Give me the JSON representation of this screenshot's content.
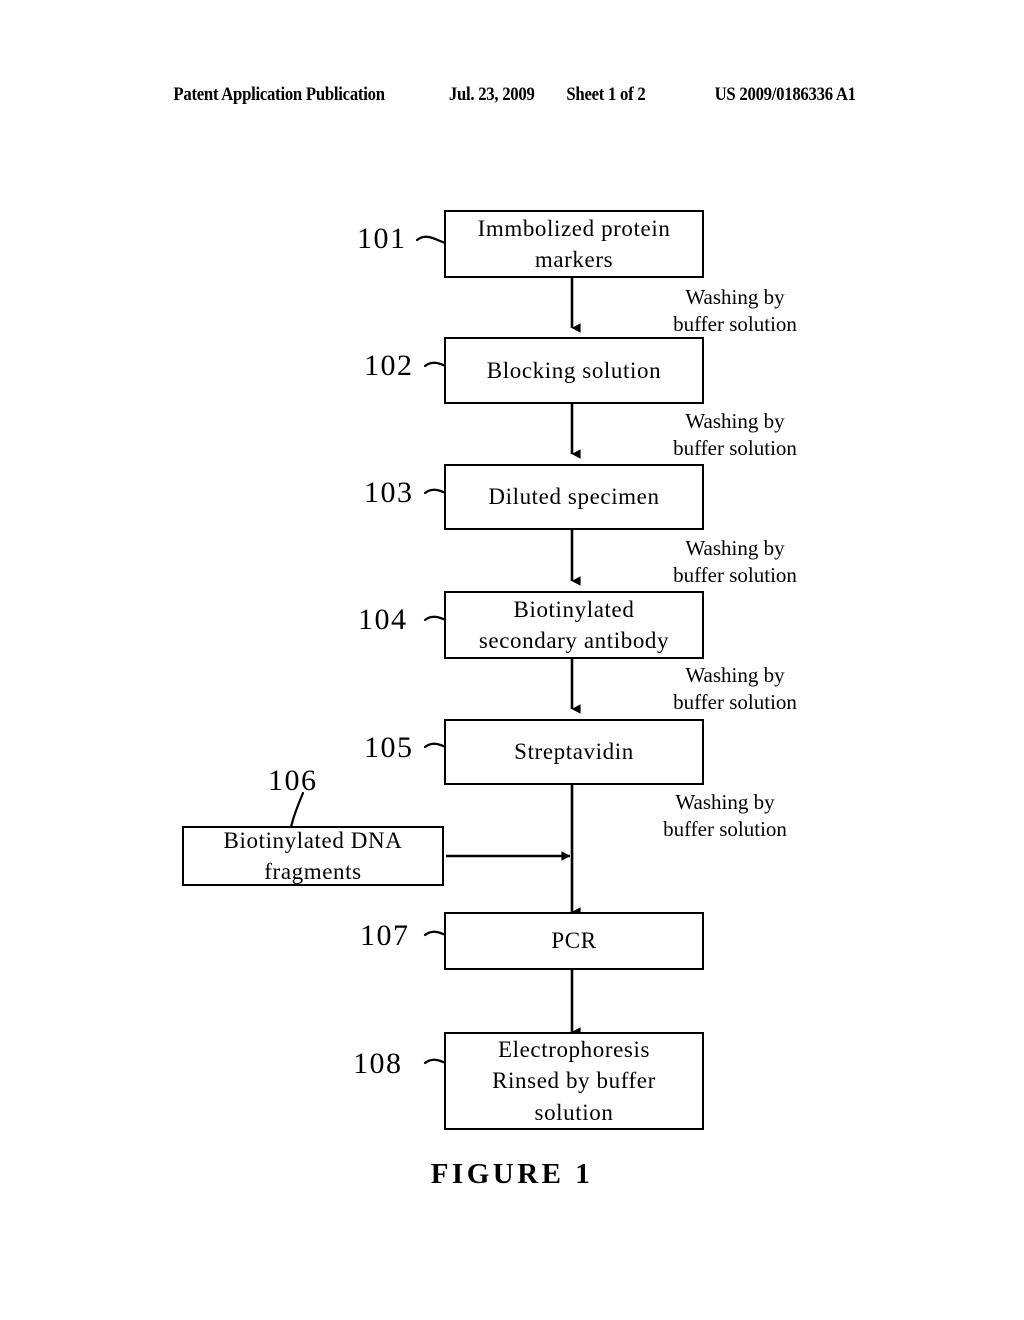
{
  "header": {
    "publication": "Patent Application Publication",
    "date": "Jul. 23, 2009",
    "sheet": "Sheet 1 of 2",
    "doc_number": "US 2009/0186336 A1"
  },
  "figure": {
    "caption": "FIGURE 1",
    "boxes": [
      {
        "ref": "101",
        "label": "Immbolized protein\nmarkers"
      },
      {
        "ref": "102",
        "label": "Blocking solution"
      },
      {
        "ref": "103",
        "label": "Diluted specimen"
      },
      {
        "ref": "104",
        "label": "Biotinylated\nsecondary antibody"
      },
      {
        "ref": "105",
        "label": "Streptavidin"
      },
      {
        "ref": "106",
        "label": "Biotinylated DNA\nfragments"
      },
      {
        "ref": "107",
        "label": "PCR"
      },
      {
        "ref": "108",
        "label": "Electrophoresis\nRinsed by buffer\nsolution"
      }
    ],
    "annotations": [
      {
        "text": "Washing by\nbuffer solution"
      },
      {
        "text": "Washing by\nbuffer solution"
      },
      {
        "text": "Washing by\nbuffer solution"
      },
      {
        "text": "Washing by\nbuffer solution"
      },
      {
        "text": "Washing by\nbuffer solution"
      }
    ]
  },
  "colors": {
    "ink": "#000000",
    "paper": "#ffffff"
  }
}
